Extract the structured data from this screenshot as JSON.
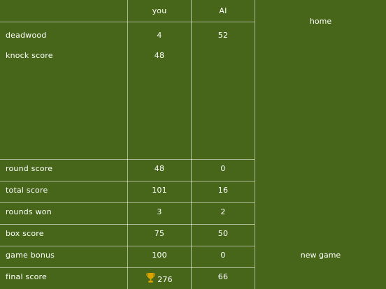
{
  "header": {
    "you": "you",
    "ai": "AI"
  },
  "rows": {
    "deadwood": {
      "label": "deadwood",
      "you": "4",
      "ai": "52"
    },
    "knock": {
      "label": "knock score",
      "you": "48",
      "ai": ""
    },
    "round": {
      "label": "round score",
      "you": "48",
      "ai": "0"
    },
    "total": {
      "label": "total score",
      "you": "101",
      "ai": "16"
    },
    "rounds_won": {
      "label": "rounds won",
      "you": "3",
      "ai": "2"
    },
    "box": {
      "label": "box score",
      "you": "75",
      "ai": "50"
    },
    "bonus": {
      "label": "game bonus",
      "you": "100",
      "ai": "0"
    },
    "final": {
      "label": "final score",
      "you": "276",
      "ai": "66"
    }
  },
  "winner_icon": "trophy-icon",
  "nav": {
    "home": "home",
    "new_game": "new game"
  },
  "colors": {
    "background": "#47661a",
    "grid": "#b9c79f",
    "trophy": "#d9a400"
  }
}
